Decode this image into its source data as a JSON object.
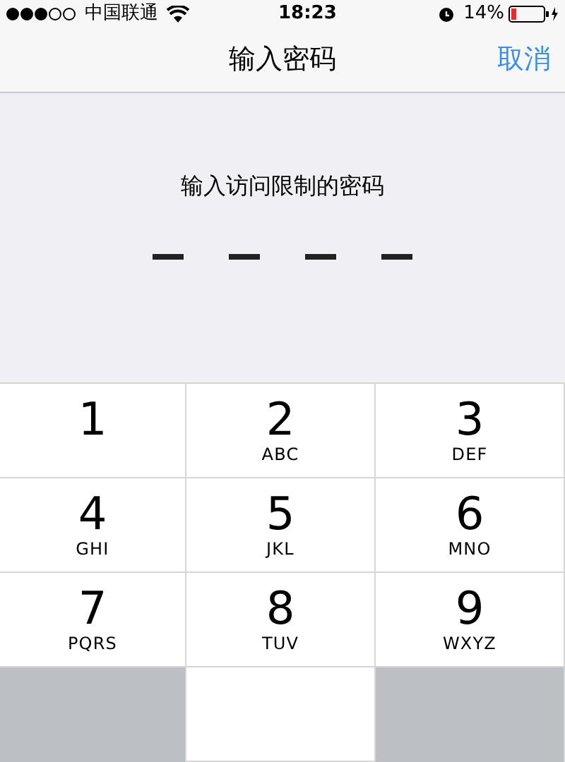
{
  "status_bar": {
    "carrier": "中国联通",
    "time": "18:23",
    "battery": "14%"
  },
  "nav": {
    "title": "输入密码",
    "cancel": "取消"
  },
  "prompt": "输入访问限制的密码",
  "slots": [
    {
      "filled": false
    },
    {
      "filled": false
    },
    {
      "filled": false
    },
    {
      "filled": false
    }
  ],
  "keypad": [
    {
      "kind": "digit",
      "digit": "1"
    },
    {
      "kind": "digit",
      "digit": "2",
      "letters": "ABC"
    },
    {
      "kind": "digit",
      "digit": "3",
      "letters": "DEF"
    },
    {
      "kind": "digit",
      "digit": "4",
      "letters": "GHI"
    },
    {
      "kind": "digit",
      "digit": "5",
      "letters": "JKL"
    },
    {
      "kind": "digit",
      "digit": "6",
      "letters": "MNO"
    },
    {
      "kind": "digit",
      "digit": "7",
      "letters": "PQRS"
    },
    {
      "kind": "digit",
      "digit": "8",
      "letters": "TUV"
    },
    {
      "kind": "digit",
      "digit": "9",
      "letters": "WXYZ"
    },
    {
      "kind": "blank"
    },
    {
      "kind": "key"
    },
    {
      "kind": "blank"
    }
  ]
}
